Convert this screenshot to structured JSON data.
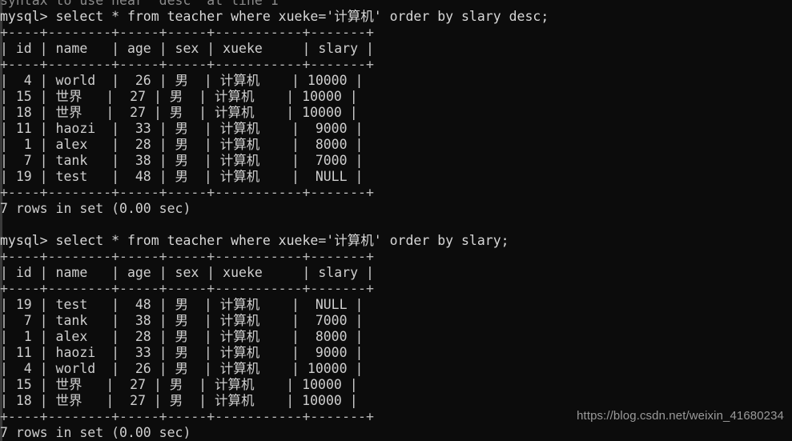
{
  "terminal": {
    "background_color": "#0c0c0c",
    "text_color": "#cfcfcf",
    "prompt": "mysql>",
    "clipped_top_line": "syntax to use near 'desc' at line 1",
    "blocks": [
      {
        "command": "mysql> select * from teacher where xueke='计算机' order by slary desc;",
        "separator": "+----+--------+-----+-----+-----------+-------+",
        "header": "| id | name   | age | sex | xueke     | slary |",
        "rows": [
          "|  4 | world  |  26 | 男  | 计算机    | 10000 |",
          "| 15 | 世界   |  27 | 男  | 计算机    | 10000 |",
          "| 18 | 世界   |  27 | 男  | 计算机    | 10000 |",
          "| 11 | haozi  |  33 | 男  | 计算机    |  9000 |",
          "|  1 | alex   |  28 | 男  | 计算机    |  8000 |",
          "|  7 | tank   |  38 | 男  | 计算机    |  7000 |",
          "| 19 | test   |  48 | 男  | 计算机    |  NULL |"
        ],
        "footer": "7 rows in set (0.00 sec)"
      },
      {
        "command": "mysql> select * from teacher where xueke='计算机' order by slary;",
        "separator": "+----+--------+-----+-----+-----------+-------+",
        "header": "| id | name   | age | sex | xueke     | slary |",
        "rows": [
          "| 19 | test   |  48 | 男  | 计算机    |  NULL |",
          "|  7 | tank   |  38 | 男  | 计算机    |  7000 |",
          "|  1 | alex   |  28 | 男  | 计算机    |  8000 |",
          "| 11 | haozi  |  33 | 男  | 计算机    |  9000 |",
          "|  4 | world  |  26 | 男  | 计算机    | 10000 |",
          "| 15 | 世界   |  27 | 男  | 计算机    | 10000 |",
          "| 18 | 世界   |  27 | 男  | 计算机    | 10000 |"
        ],
        "footer": "7 rows in set (0.00 sec)"
      }
    ],
    "table_columns": [
      "id",
      "name",
      "age",
      "sex",
      "xueke",
      "slary"
    ],
    "result_sets": [
      {
        "order": "slary desc",
        "rows": [
          {
            "id": "4",
            "name": "world",
            "age": "26",
            "sex": "男",
            "xueke": "计算机",
            "slary": "10000"
          },
          {
            "id": "15",
            "name": "世界",
            "age": "27",
            "sex": "男",
            "xueke": "计算机",
            "slary": "10000"
          },
          {
            "id": "18",
            "name": "世界",
            "age": "27",
            "sex": "男",
            "xueke": "计算机",
            "slary": "10000"
          },
          {
            "id": "11",
            "name": "haozi",
            "age": "33",
            "sex": "男",
            "xueke": "计算机",
            "slary": "9000"
          },
          {
            "id": "1",
            "name": "alex",
            "age": "28",
            "sex": "男",
            "xueke": "计算机",
            "slary": "8000"
          },
          {
            "id": "7",
            "name": "tank",
            "age": "38",
            "sex": "男",
            "xueke": "计算机",
            "slary": "7000"
          },
          {
            "id": "19",
            "name": "test",
            "age": "48",
            "sex": "男",
            "xueke": "计算机",
            "slary": "NULL"
          }
        ],
        "row_count_text": "7 rows in set (0.00 sec)"
      },
      {
        "order": "slary",
        "rows": [
          {
            "id": "19",
            "name": "test",
            "age": "48",
            "sex": "男",
            "xueke": "计算机",
            "slary": "NULL"
          },
          {
            "id": "7",
            "name": "tank",
            "age": "38",
            "sex": "男",
            "xueke": "计算机",
            "slary": "7000"
          },
          {
            "id": "1",
            "name": "alex",
            "age": "28",
            "sex": "男",
            "xueke": "计算机",
            "slary": "8000"
          },
          {
            "id": "11",
            "name": "haozi",
            "age": "33",
            "sex": "男",
            "xueke": "计算机",
            "slary": "9000"
          },
          {
            "id": "4",
            "name": "world",
            "age": "26",
            "sex": "男",
            "xueke": "计算机",
            "slary": "10000"
          },
          {
            "id": "15",
            "name": "世界",
            "age": "27",
            "sex": "男",
            "xueke": "计算机",
            "slary": "10000"
          },
          {
            "id": "18",
            "name": "世界",
            "age": "27",
            "sex": "男",
            "xueke": "计算机",
            "slary": "10000"
          }
        ],
        "row_count_text": "7 rows in set (0.00 sec)"
      }
    ]
  },
  "watermark": {
    "text": "https://blog.csdn.net/weixin_41680234"
  }
}
